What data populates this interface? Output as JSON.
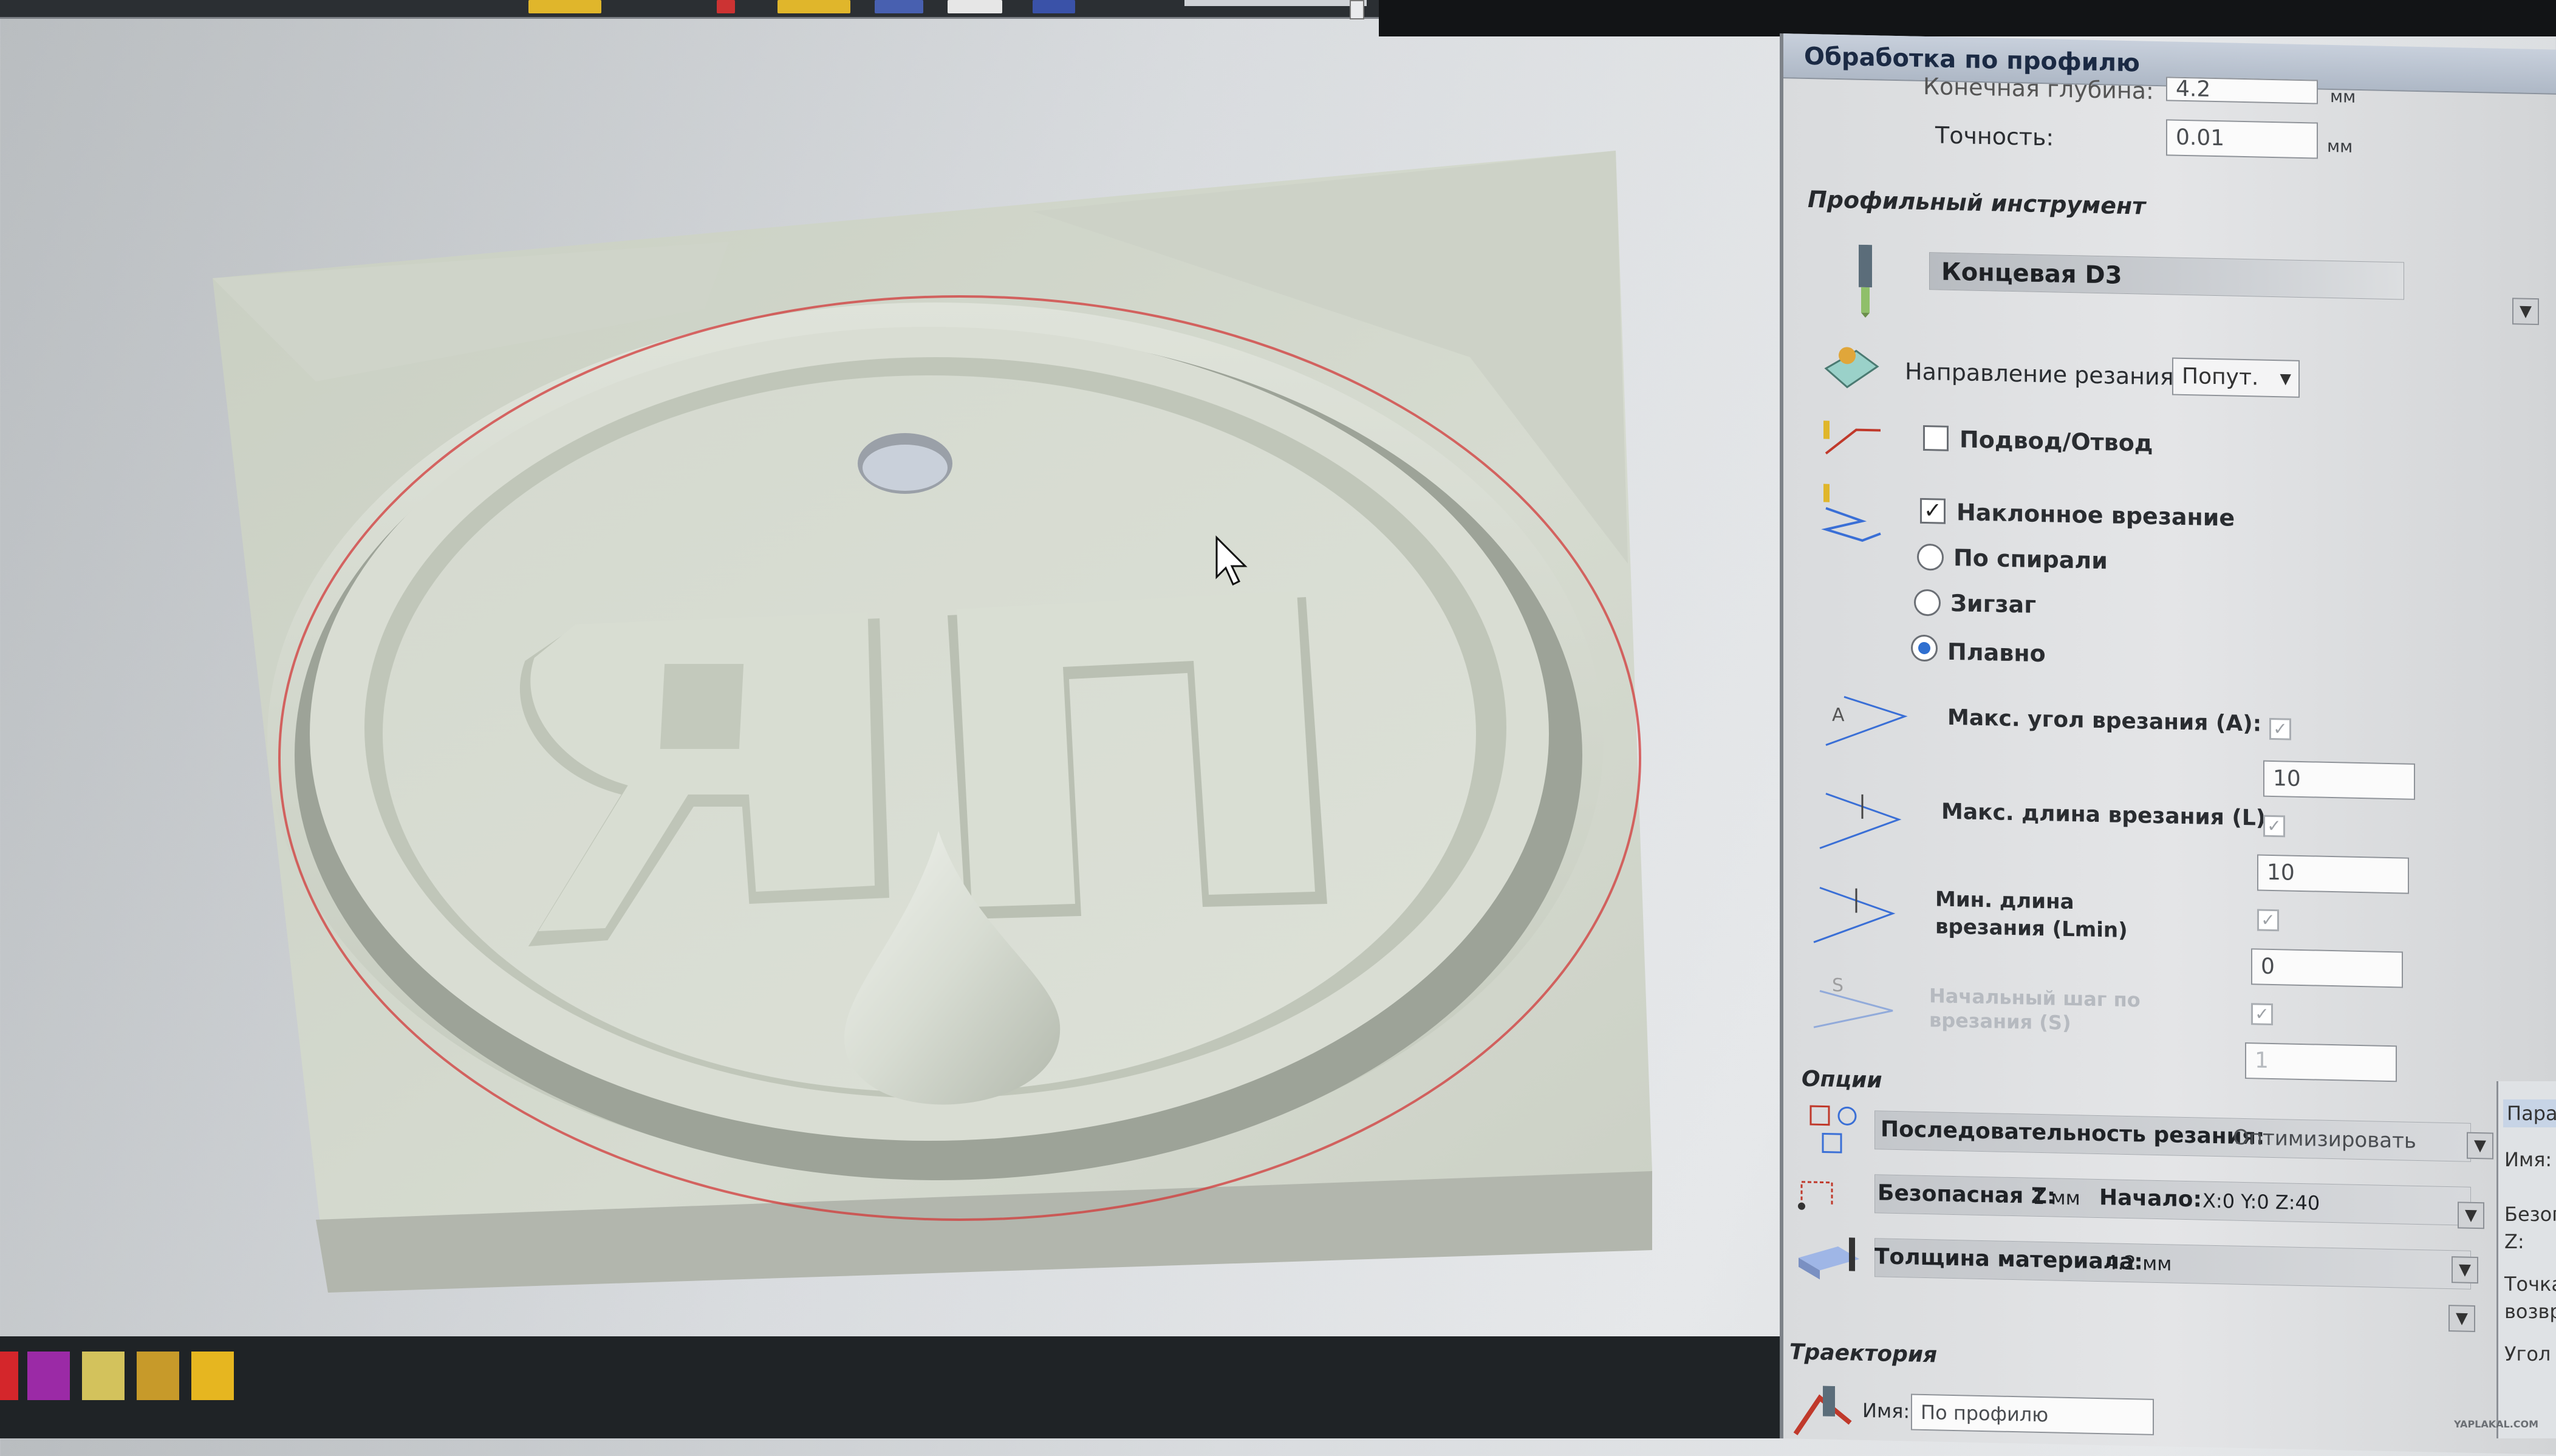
{
  "panel": {
    "title": "Обработка по профилю",
    "final_depth_label": "Конечная глубина:",
    "final_depth_value": "4.2",
    "final_depth_unit": "мм",
    "precision_label": "Точность:",
    "precision_value": "0.01",
    "precision_unit": "мм",
    "tool_section": "Профильный инструмент",
    "tool_name": "Концевая D3",
    "cut_direction_label": "Направление резания:",
    "cut_direction_value": "Попут.",
    "lead_in_out_label": "Подвод/Отвод",
    "lead_in_out_checked": false,
    "ramp_label": "Наклонное врезание",
    "ramp_checked": true,
    "ramp_options": [
      "По спирали",
      "Зигзаг",
      "Плавно"
    ],
    "ramp_selected": "Плавно",
    "max_angle_label": "Макс. угол врезания  (A):",
    "max_angle_value": "10",
    "max_length_label": "Макс. длина врезания (L)",
    "max_length_value": "10",
    "min_length_label_1": "Мин. длина",
    "min_length_label_2": "врезания (Lmin)",
    "min_length_value": "0",
    "step_label_1": "Начальный шаг по",
    "step_label_2": "врезания (S)",
    "step_value": "1",
    "options_section": "Опции",
    "sequence_label": "Последовательность резания:",
    "sequence_value": "Оптимизировать",
    "safe_z_label": "Безопасная Z:",
    "safe_z_value": "1 мм",
    "start_label": "Начало:",
    "start_value": "X:0 Y:0 Z:40",
    "thickness_label": "Толщина материала:",
    "thickness_value": "4.2 мм",
    "trajectory_section": "Траектория",
    "name_label": "Имя:",
    "name_value": "По профилю"
  },
  "side_panel": {
    "tab": "Пара",
    "labels": [
      "Имя:",
      "Безопа",
      "Z:",
      "Точка",
      "возврат",
      "Угол ос"
    ]
  },
  "viewport": {
    "logo_letters": "ЯП"
  },
  "watermark": "YAPLAKAL.COM",
  "colors": {
    "model": "#c6cdbf",
    "toolpath": "#d23a3a",
    "palette": [
      "#d4262b",
      "#9b2aa6",
      "#d3c25c",
      "#c79a2a",
      "#e6b620"
    ]
  }
}
